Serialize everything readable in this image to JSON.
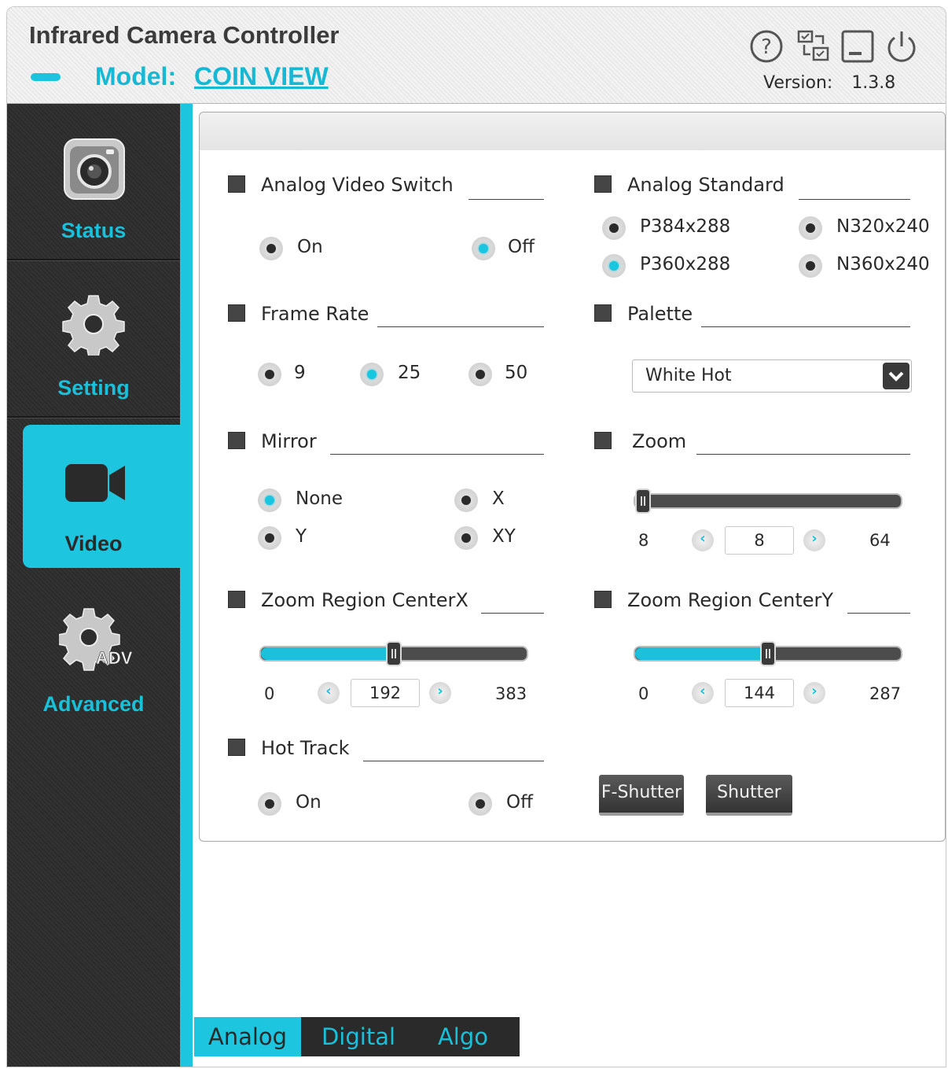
{
  "header": {
    "app_title": "Infrared Camera Controller",
    "model_label": "Model:",
    "model_value": "COIN VIEW",
    "version_label": "Version:",
    "version_value": "1.3.8",
    "icons": [
      "help-icon",
      "switch-window-icon",
      "minimize-icon",
      "power-icon"
    ]
  },
  "sidebar": {
    "items": [
      {
        "label": "Status",
        "icon": "camera-icon",
        "active": false
      },
      {
        "label": "Setting",
        "icon": "gear-icon",
        "active": false
      },
      {
        "label": "Video",
        "icon": "video-camera-icon",
        "active": true
      },
      {
        "label": "Advanced",
        "icon": "gear-adv-icon",
        "active": false
      }
    ],
    "adv_badge": "ADV"
  },
  "sections": {
    "analog_video_switch": {
      "title": "Analog Video Switch",
      "options": [
        "On",
        "Off"
      ],
      "selected": "Off"
    },
    "analog_standard": {
      "title": "Analog Standard",
      "options": [
        "P384x288",
        "N320x240",
        "P360x288",
        "N360x240"
      ],
      "selected": "P360x288"
    },
    "frame_rate": {
      "title": "Frame Rate",
      "options": [
        "9",
        "25",
        "50"
      ],
      "selected": "25"
    },
    "palette": {
      "title": "Palette",
      "selected": "White Hot"
    },
    "mirror": {
      "title": "Mirror",
      "options": [
        "None",
        "X",
        "Y",
        "XY"
      ],
      "selected": "None"
    },
    "zoom": {
      "title": "Zoom",
      "min": "8",
      "value": "8",
      "max": "64",
      "fraction": 0.0
    },
    "zoom_center_x": {
      "title": "Zoom Region CenterX",
      "min": "0",
      "value": "192",
      "max": "383",
      "fraction": 0.5
    },
    "zoom_center_y": {
      "title": "Zoom Region CenterY",
      "min": "0",
      "value": "144",
      "max": "287",
      "fraction": 0.5
    },
    "hot_track": {
      "title": "Hot Track",
      "options": [
        "On",
        "Off"
      ],
      "selected": null
    }
  },
  "buttons": {
    "f_shutter": "F-Shutter",
    "shutter": "Shutter"
  },
  "step_glyphs": {
    "prev": "‹",
    "next": "›"
  },
  "tabs": [
    {
      "label": "Analog",
      "active": true
    },
    {
      "label": "Digital",
      "active": false
    },
    {
      "label": "Algo",
      "active": false
    }
  ],
  "colors": {
    "accent": "#1DC6DE",
    "sidebar_bg": "#2E2E2E",
    "radio_selected": "#19C6E0"
  }
}
